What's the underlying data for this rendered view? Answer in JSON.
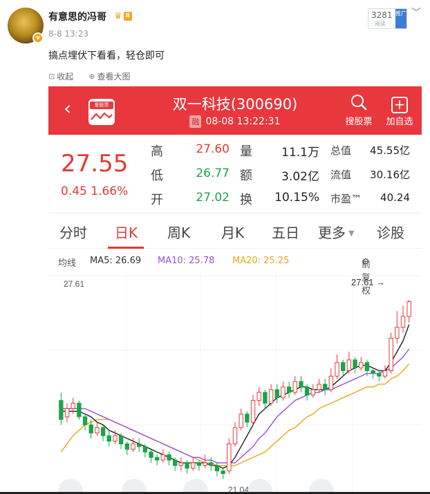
{
  "post": {
    "username": "有意思的冯哥",
    "vip_level": "Ⅱ",
    "time": "8-8 13:23",
    "reads": "3281",
    "reads_label": "阅读",
    "promote_label": "推广",
    "text": "搞点埋伏下看看，轻仓即可",
    "collect_label": "收起",
    "view_large_label": "查看大图"
  },
  "stock": {
    "title": "双一科技(300690)",
    "rong": "融",
    "datetime": "08-08 13:22:31",
    "app_logo_text": "爱股票",
    "search_label": "搜股票",
    "add_label": "加自选",
    "price": "27.55",
    "change": "0.45",
    "change_pct": "1.66%",
    "quote": [
      {
        "label": "高",
        "value": "27.60",
        "color": "red"
      },
      {
        "label": "低",
        "value": "26.77",
        "color": "green"
      },
      {
        "label": "开",
        "value": "27.02",
        "color": "green"
      }
    ],
    "quote2": [
      {
        "label": "量",
        "value": "11.1万"
      },
      {
        "label": "额",
        "value": "3.02亿"
      },
      {
        "label": "换",
        "value": "10.15%"
      }
    ],
    "quote3": [
      {
        "label": "总值",
        "value": "45.55亿"
      },
      {
        "label": "流值",
        "value": "30.16亿"
      },
      {
        "label": "市盈™",
        "value": "40.24"
      }
    ],
    "tabs": [
      "分时",
      "日K",
      "周K",
      "月K",
      "五日",
      "更多",
      "诊股"
    ],
    "active_tab": "日K",
    "ma": {
      "label": "均线",
      "ma5": "MA5: 26.69",
      "ma10": "MA10: 25.78",
      "ma20": "MA20: 25.25",
      "adjust": "前复权",
      "colors": {
        "ma5": "#222222",
        "ma10": "#9b4fd6",
        "ma20": "#e6a817"
      }
    },
    "chart_high_label": "27.61",
    "chart_high_marker": "27.61",
    "chart_low_label": "21.04"
  },
  "chart_data": {
    "type": "candlestick",
    "ylim": [
      20.5,
      28.2
    ],
    "up_color": "#e53935",
    "down_color": "#1aa34a",
    "candles": [
      [
        23.9,
        23.2,
        24.2,
        23.0
      ],
      [
        23.3,
        23.6,
        23.8,
        23.1
      ],
      [
        23.6,
        23.8,
        24.0,
        23.4
      ],
      [
        23.8,
        23.3,
        23.9,
        23.2
      ],
      [
        23.3,
        23.0,
        23.4,
        22.8
      ],
      [
        23.0,
        22.7,
        23.2,
        22.5
      ],
      [
        22.7,
        22.9,
        23.1,
        22.6
      ],
      [
        22.9,
        22.6,
        23.0,
        22.4
      ],
      [
        22.6,
        22.4,
        22.8,
        22.2
      ],
      [
        22.4,
        22.6,
        22.8,
        22.3
      ],
      [
        22.6,
        22.3,
        22.7,
        22.1
      ],
      [
        22.3,
        22.1,
        22.4,
        21.9
      ],
      [
        22.1,
        22.3,
        22.5,
        22.0
      ],
      [
        22.3,
        22.2,
        22.5,
        22.0
      ],
      [
        22.2,
        22.0,
        22.3,
        21.8
      ],
      [
        22.0,
        21.8,
        22.1,
        21.6
      ],
      [
        21.8,
        21.7,
        21.9,
        21.5
      ],
      [
        21.7,
        21.9,
        22.1,
        21.6
      ],
      [
        21.9,
        21.7,
        22.0,
        21.5
      ],
      [
        21.7,
        21.5,
        21.8,
        21.3
      ],
      [
        21.5,
        21.6,
        21.8,
        21.3
      ],
      [
        21.6,
        21.4,
        21.7,
        21.2
      ],
      [
        21.4,
        21.6,
        21.8,
        21.3
      ],
      [
        21.6,
        21.5,
        21.7,
        21.3
      ],
      [
        21.5,
        21.6,
        21.9,
        21.4
      ],
      [
        21.6,
        21.5,
        21.8,
        21.3
      ],
      [
        21.5,
        21.3,
        21.6,
        21.1
      ],
      [
        21.3,
        21.2,
        21.4,
        21.0
      ],
      [
        21.3,
        22.3,
        22.5,
        21.2
      ],
      [
        22.3,
        22.9,
        23.1,
        22.2
      ],
      [
        22.9,
        23.4,
        23.6,
        22.8
      ],
      [
        23.4,
        23.1,
        23.5,
        22.9
      ],
      [
        23.1,
        23.9,
        24.1,
        23.0
      ],
      [
        23.9,
        24.2,
        24.4,
        23.7
      ],
      [
        24.2,
        23.8,
        24.3,
        23.6
      ],
      [
        23.8,
        24.3,
        24.5,
        23.7
      ],
      [
        24.3,
        24.0,
        24.5,
        23.8
      ],
      [
        24.0,
        24.4,
        24.6,
        23.9
      ],
      [
        24.4,
        24.2,
        24.6,
        24.0
      ],
      [
        24.2,
        24.6,
        24.8,
        24.1
      ],
      [
        24.6,
        24.4,
        24.8,
        24.2
      ],
      [
        24.4,
        24.1,
        24.5,
        23.9
      ],
      [
        24.1,
        24.3,
        24.5,
        24.0
      ],
      [
        24.3,
        24.5,
        24.7,
        24.2
      ],
      [
        24.5,
        24.3,
        24.7,
        24.1
      ],
      [
        24.3,
        24.8,
        25.1,
        24.2
      ],
      [
        24.8,
        25.3,
        25.6,
        24.7
      ],
      [
        25.3,
        25.0,
        25.4,
        24.8
      ],
      [
        25.0,
        25.4,
        25.7,
        24.9
      ],
      [
        25.4,
        25.1,
        25.5,
        24.9
      ],
      [
        25.1,
        25.3,
        25.5,
        25.0
      ],
      [
        25.3,
        25.0,
        25.4,
        24.8
      ],
      [
        25.0,
        24.9,
        25.1,
        24.7
      ],
      [
        24.9,
        24.8,
        25.0,
        24.6
      ],
      [
        24.8,
        25.0,
        25.2,
        24.7
      ],
      [
        25.0,
        26.2,
        26.4,
        24.9
      ],
      [
        26.2,
        26.6,
        27.2,
        26.0
      ],
      [
        26.6,
        27.0,
        27.4,
        26.4
      ],
      [
        27.0,
        27.55,
        27.61,
        26.77
      ]
    ],
    "ma5": [
      23.5,
      23.5,
      23.5,
      23.5,
      23.4,
      23.3,
      23.1,
      23.0,
      22.8,
      22.7,
      22.6,
      22.5,
      22.4,
      22.3,
      22.2,
      22.1,
      22.0,
      21.9,
      21.8,
      21.7,
      21.6,
      21.6,
      21.6,
      21.6,
      21.6,
      21.5,
      21.5,
      21.4,
      21.5,
      21.8,
      22.2,
      22.6,
      23.0,
      23.4,
      23.6,
      23.8,
      24.0,
      24.1,
      24.2,
      24.3,
      24.4,
      24.4,
      24.3,
      24.3,
      24.3,
      24.4,
      24.6,
      24.8,
      25.0,
      25.1,
      25.2,
      25.2,
      25.1,
      25.0,
      25.0,
      25.3,
      25.7,
      26.1,
      26.7
    ],
    "ma10": [
      23.6,
      23.6,
      23.6,
      23.6,
      23.6,
      23.5,
      23.4,
      23.3,
      23.2,
      23.1,
      23.0,
      22.9,
      22.8,
      22.7,
      22.6,
      22.5,
      22.4,
      22.3,
      22.2,
      22.1,
      22.0,
      21.9,
      21.8,
      21.8,
      21.7,
      21.7,
      21.6,
      21.6,
      21.6,
      21.6,
      21.8,
      22.0,
      22.2,
      22.5,
      22.7,
      23.0,
      23.3,
      23.5,
      23.7,
      23.9,
      24.0,
      24.1,
      24.2,
      24.2,
      24.3,
      24.3,
      24.4,
      24.5,
      24.6,
      24.7,
      24.8,
      24.9,
      24.9,
      24.9,
      25.0,
      25.1,
      25.3,
      25.5,
      25.8
    ],
    "ma20": [
      22.0,
      22.3,
      22.6,
      22.8,
      23.0,
      23.1,
      23.2,
      23.2,
      23.2,
      23.1,
      23.0,
      22.9,
      22.8,
      22.7,
      22.6,
      22.5,
      22.4,
      22.3,
      22.2,
      22.1,
      22.0,
      21.9,
      21.8,
      21.7,
      21.6,
      21.6,
      21.5,
      21.5,
      21.5,
      21.5,
      21.6,
      21.7,
      21.8,
      21.9,
      22.0,
      22.2,
      22.4,
      22.6,
      22.8,
      22.9,
      23.1,
      23.3,
      23.4,
      23.6,
      23.7,
      23.8,
      23.9,
      24.0,
      24.1,
      24.2,
      24.3,
      24.4,
      24.4,
      24.5,
      24.5,
      24.7,
      24.8,
      25.0,
      25.25
    ]
  }
}
